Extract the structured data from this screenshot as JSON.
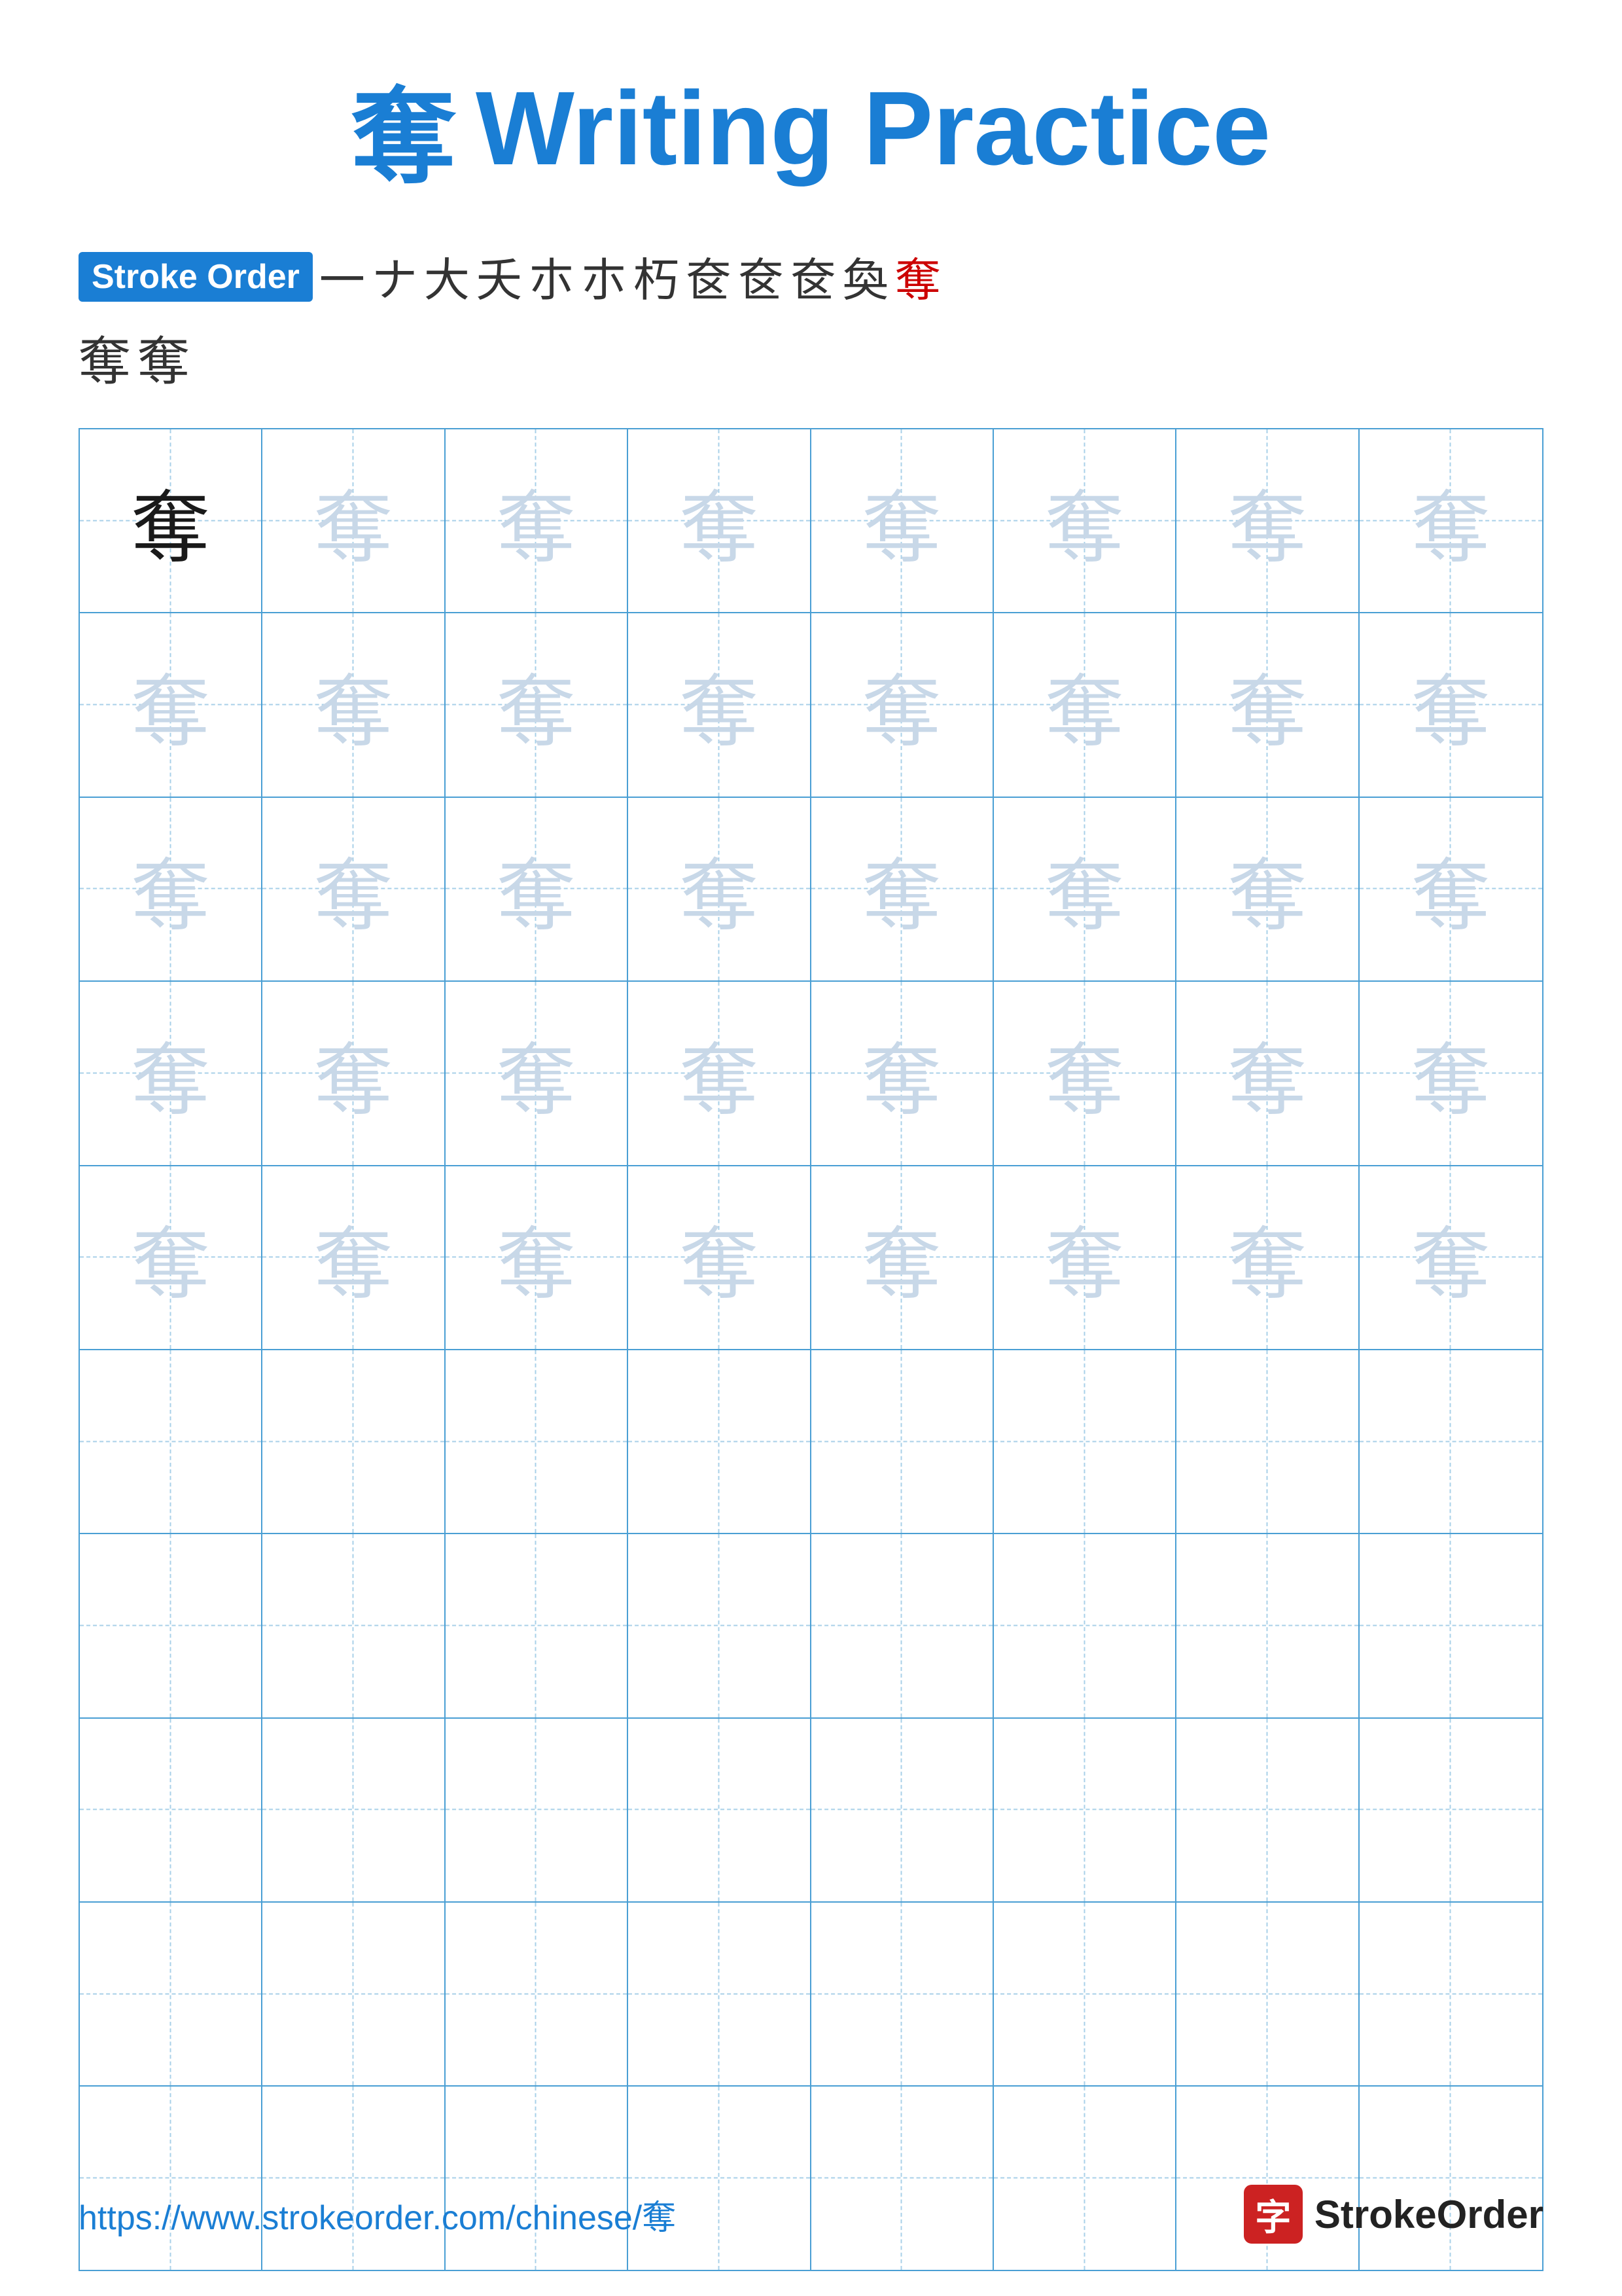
{
  "title": {
    "char": "奪",
    "text": "Writing Practice"
  },
  "stroke_order": {
    "label": "Stroke Order",
    "chars_row1": [
      "一",
      "ナ",
      "大",
      "夭",
      "朩",
      "朩",
      "朽",
      "奁",
      "奁",
      "奁",
      "奐",
      "奪"
    ],
    "chars_row2": [
      "奪",
      "奪"
    ]
  },
  "grid": {
    "rows": 10,
    "cols": 8,
    "character": "奪",
    "practice_rows": 5,
    "empty_rows": 5
  },
  "footer": {
    "url": "https://www.strokeorder.com/chinese/奪",
    "brand": "StrokeOrder",
    "brand_icon": "字"
  }
}
